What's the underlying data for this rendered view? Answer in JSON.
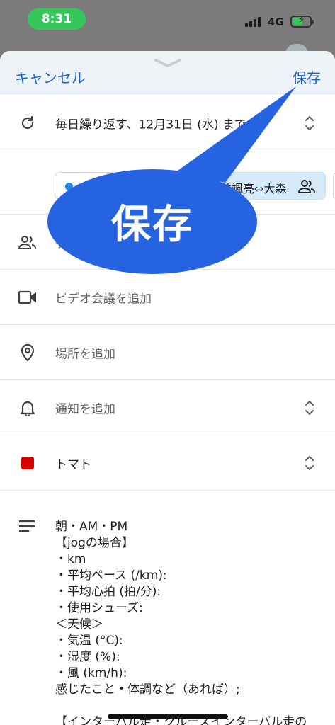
{
  "status_bar": {
    "time": "8:31",
    "network": "4G"
  },
  "header": {
    "cancel_label": "キャンセル",
    "save_label": "保存"
  },
  "repeat": {
    "label": "毎日繰り返す、12月31日 (水) まで"
  },
  "chips": {
    "calendar_label": "マ",
    "shared_label": "井颯亮⇔大森"
  },
  "guests": {
    "label": "ゲ"
  },
  "video": {
    "label": "ビデオ会議を追加"
  },
  "place": {
    "label": "場所を追加"
  },
  "notification": {
    "label": "通知を追加"
  },
  "color": {
    "label": "トマト",
    "value": "#d50000"
  },
  "description": {
    "lines": [
      "朝・AM・PM",
      "【jogの場合】",
      "・km",
      "・平均ペース (/km):",
      "・平均心拍 (拍/分):",
      "・使用シューズ:",
      "＜天候＞",
      "・気温 (°C):",
      "・湿度 (%):",
      "・風 (km/h):",
      "感じたこと・体調など（あれば）;",
      "",
      "【インターバル走・クルーズインターバル走の"
    ]
  },
  "callout": {
    "text": "保存",
    "color": "#2563e0"
  }
}
